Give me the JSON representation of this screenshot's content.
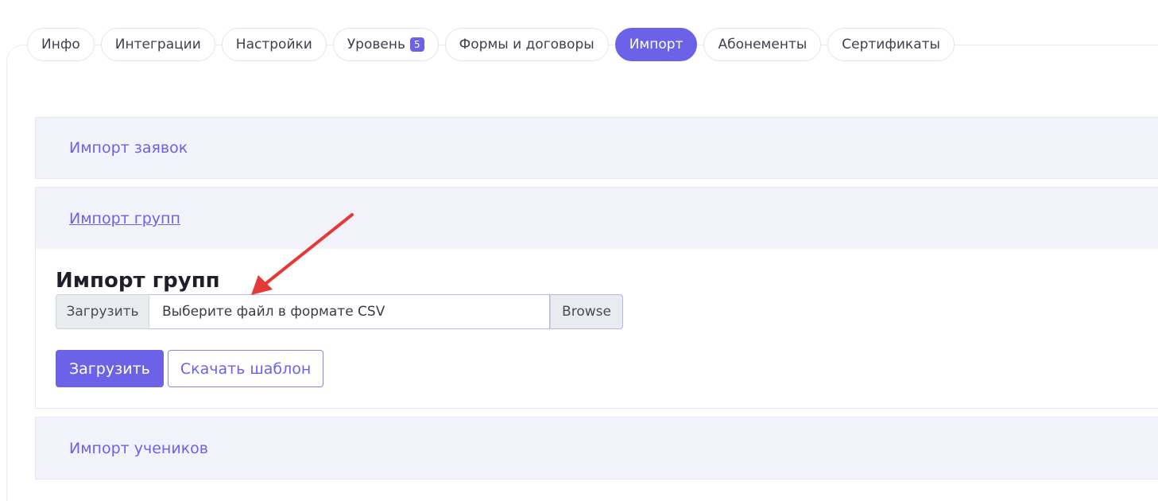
{
  "tabs": [
    {
      "label": "Инфо"
    },
    {
      "label": "Интеграции"
    },
    {
      "label": "Настройки"
    },
    {
      "label": "Уровень",
      "badge": "5"
    },
    {
      "label": "Формы и договоры"
    },
    {
      "label": "Импорт",
      "active": true
    },
    {
      "label": "Абонементы"
    },
    {
      "label": "Сертификаты"
    }
  ],
  "sections": {
    "orders": {
      "title": "Импорт заявок"
    },
    "groups": {
      "title": "Импорт групп",
      "body_title": "Импорт групп",
      "upload_prefix": "Загрузить",
      "file_placeholder": "Выберите файл в формате CSV",
      "browse_label": "Browse",
      "submit_label": "Загрузить",
      "template_label": "Скачать шаблон"
    },
    "students": {
      "title": "Импорт учеников"
    }
  },
  "colors": {
    "accent": "#6b62e8",
    "header_bg": "#f2f2fb",
    "annotation_arrow": "#e53935"
  },
  "icons": {
    "annotation": "red-arrow-annotation"
  }
}
